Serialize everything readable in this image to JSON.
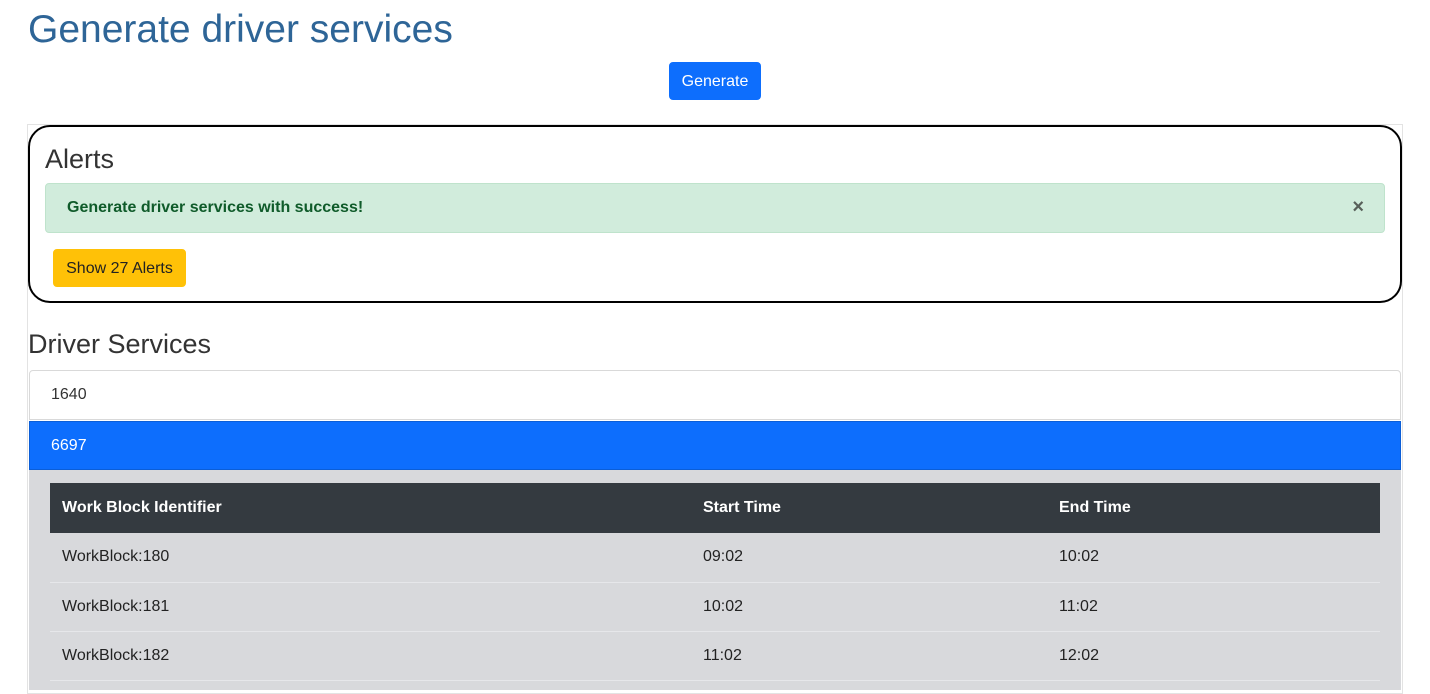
{
  "header": {
    "title": "Generate driver services",
    "generate_label": "Generate"
  },
  "alerts": {
    "heading": "Alerts",
    "success_message": "Generate driver services with success!",
    "close_glyph": "×",
    "show_button_label": "Show 27 Alerts",
    "colors": {
      "success_bg": "#d1ecdc",
      "warning": "#ffc107"
    }
  },
  "driver_services": {
    "heading": "Driver Services",
    "items": [
      {
        "label": "1640",
        "active": false
      },
      {
        "label": "6697",
        "active": true
      }
    ],
    "table": {
      "columns": [
        "Work Block Identifier",
        "Start Time",
        "End Time"
      ],
      "rows": [
        [
          "WorkBlock:180",
          "09:02",
          "10:02"
        ],
        [
          "WorkBlock:181",
          "10:02",
          "11:02"
        ],
        [
          "WorkBlock:182",
          "11:02",
          "12:02"
        ]
      ]
    }
  },
  "colors": {
    "primary": "#0d6efd",
    "title": "#2e6597",
    "table_header": "#343a40"
  }
}
